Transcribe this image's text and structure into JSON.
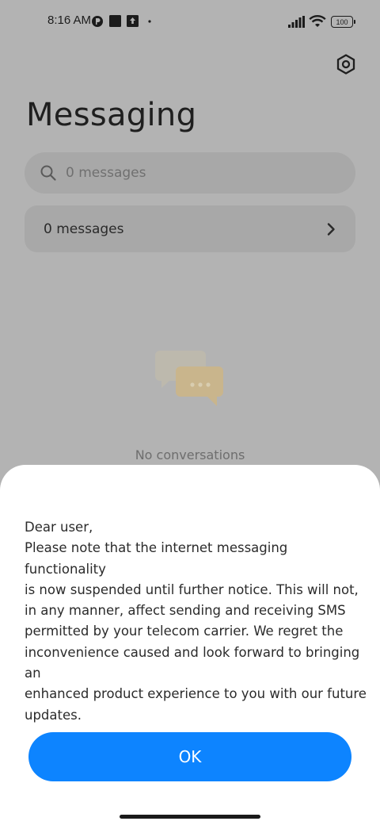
{
  "status_bar": {
    "time": "8:16 AM",
    "battery": "100"
  },
  "header": {
    "title": "Messaging"
  },
  "search": {
    "placeholder": "0 messages"
  },
  "messages_row": {
    "label": "0 messages"
  },
  "empty_state": {
    "text": "No conversations"
  },
  "dialog": {
    "message": "Dear user,\nPlease note that the internet messaging functionality\nis now suspended until further notice. This will not,\nin any manner, affect sending and receiving SMS\npermitted by your telecom carrier. We regret the\ninconvenience caused and look forward to bringing an\nenhanced product experience to you with our future\nupdates.",
    "ok_label": "OK"
  },
  "colors": {
    "accent": "#0d84ff",
    "dim_background": "#b3b3b3",
    "sheet_background": "#ffffff"
  },
  "icons": [
    "settings-icon",
    "search-icon",
    "chevron-right-icon",
    "chat-bubbles-icon",
    "signal-icon",
    "wifi-icon",
    "battery-icon"
  ]
}
